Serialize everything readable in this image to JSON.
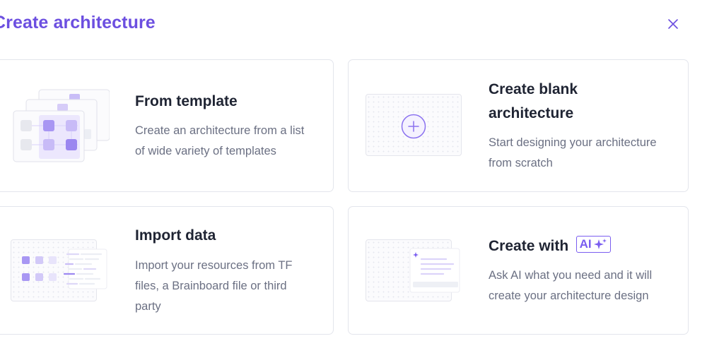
{
  "modal": {
    "title": "Create architecture"
  },
  "options": {
    "template": {
      "title": "From template",
      "description_line1": "Create an architecture from a list",
      "description_line2": "of wide variety of templates"
    },
    "blank": {
      "title_line1": "Create blank",
      "title_line2": "architecture",
      "description_line1": "Start designing your architecture",
      "description_line2": "from scratch"
    },
    "import": {
      "title": "Import data",
      "description_line1": "Import your resources from TF",
      "description_line2": "files, a Brainboard file or third",
      "description_line3": "party"
    },
    "ai": {
      "title": "Create with",
      "badge": "AI",
      "description_line1": "Ask AI what you need and it will",
      "description_line2": "create your architecture design"
    }
  },
  "icons": {
    "close": "close-icon",
    "plus": "plus-circle-icon",
    "sparkle": "sparkle-icon"
  },
  "colors": {
    "accent": "#6c4fe0",
    "title_text": "#1f2433",
    "body_text": "#6b7083",
    "card_border": "#e3e5ec"
  }
}
